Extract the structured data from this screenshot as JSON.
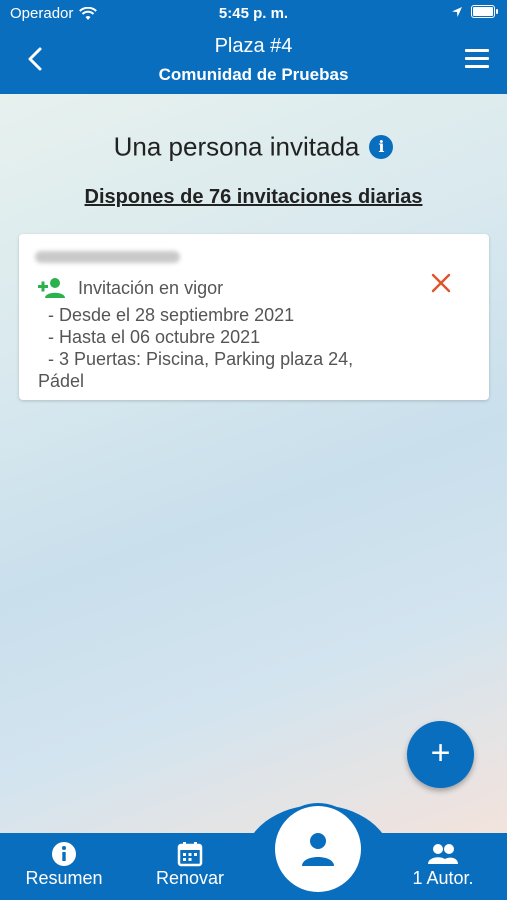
{
  "status_bar": {
    "carrier": "Operador",
    "time": "5:45 p. m."
  },
  "nav": {
    "title": "Plaza #4",
    "subtitle": "Comunidad de Pruebas"
  },
  "heading": "Una persona invitada",
  "invitations_text": "Dispones de 76 invitaciones diarias",
  "invitation": {
    "status": "Invitación en vigor",
    "from": "- Desde el 28 septiembre 2021",
    "until": "- Hasta el 06 octubre 2021",
    "doors_line1": "- 3 Puertas: Piscina, Parking plaza 24,",
    "doors_line2": "Pádel"
  },
  "tabs": {
    "summary": "Resumen",
    "renew": "Renovar",
    "authorized": "1 Autor."
  },
  "fab_label": "+",
  "colors": {
    "primary": "#0a6ebf",
    "success": "#2bb24c",
    "danger": "#e0542a"
  }
}
